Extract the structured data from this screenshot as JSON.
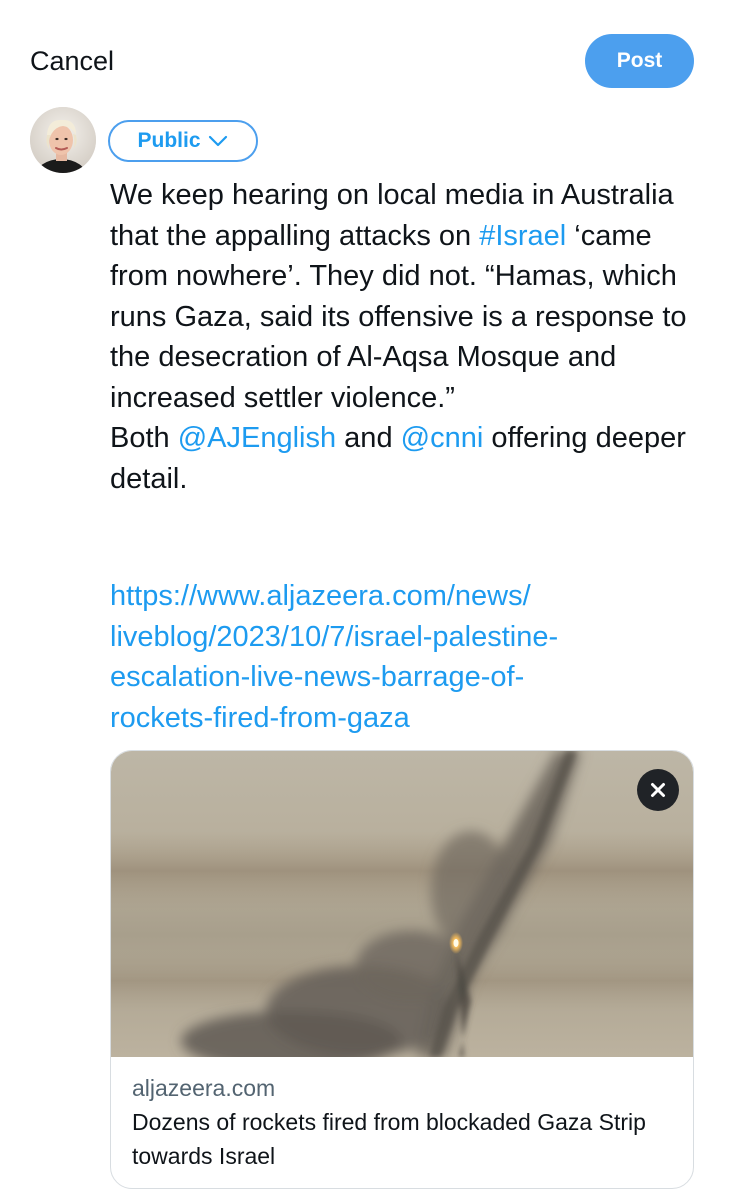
{
  "header": {
    "cancel_label": "Cancel",
    "post_label": "Post"
  },
  "composer": {
    "audience_label": "Public",
    "text_segments": [
      {
        "text": "We keep hearing on local media in Australia that the appalling attacks on ",
        "type": "text"
      },
      {
        "text": "#Israel",
        "type": "hashtag"
      },
      {
        "text": " ‘came from nowhere’. They did not. “Hamas, which runs Gaza, said its offensive is a response to the desecration of Al-Aqsa Mosque and increased settler violence.”\nBoth ",
        "type": "text"
      },
      {
        "text": "@AJEnglish",
        "type": "mention"
      },
      {
        "text": " and ",
        "type": "text"
      },
      {
        "text": "@cnni",
        "type": "mention"
      },
      {
        "text": " offering deeper detail.",
        "type": "text"
      }
    ],
    "url_lines": [
      "https://www.aljazeera.com/news/",
      "liveblog/2023/10/7/israel-palestine-",
      "escalation-live-news-barrage-of-",
      "rockets-fired-from-gaza"
    ]
  },
  "link_card": {
    "domain": "aljazeera.com",
    "title": "Dozens of rockets fired from blockaded Gaza Strip towards Israel",
    "image_icon": "rocket-smoke-photo"
  },
  "colors": {
    "accent": "#1d9bf0",
    "post_button": "#4c9fee",
    "text": "#0f1419",
    "secondary_text": "#536471"
  }
}
